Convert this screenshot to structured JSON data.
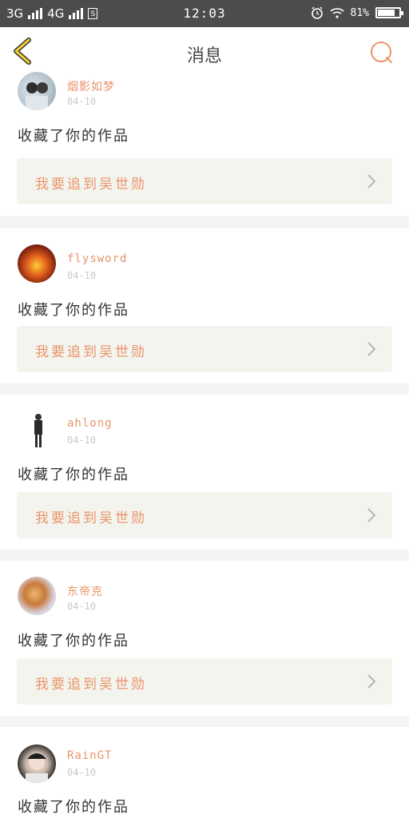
{
  "status_bar": {
    "network1": "3G",
    "network2": "4G",
    "sim_label": "S",
    "time": "12:03",
    "battery_percent": "81%",
    "battery_level": 0.81
  },
  "nav": {
    "title": "消息",
    "back_icon": "chevron-left-icon",
    "search_icon": "search-icon",
    "accent": "#e9956b"
  },
  "messages": [
    {
      "user": "烟影如梦",
      "date": "04-10",
      "action": "收藏了你的作品",
      "work_title": "我要追到吴世勋"
    },
    {
      "user": "flysword",
      "date": "04-10",
      "action": "收藏了你的作品",
      "work_title": "我要追到吴世勋"
    },
    {
      "user": "ahlong",
      "date": "04-10",
      "action": "收藏了你的作品",
      "work_title": "我要追到吴世勋"
    },
    {
      "user": "东帝克",
      "date": "04-10",
      "action": "收藏了你的作品",
      "work_title": "我要追到吴世勋"
    },
    {
      "user": "RainGT",
      "date": "04-10",
      "action": "收藏了你的作品",
      "work_title": ""
    }
  ]
}
